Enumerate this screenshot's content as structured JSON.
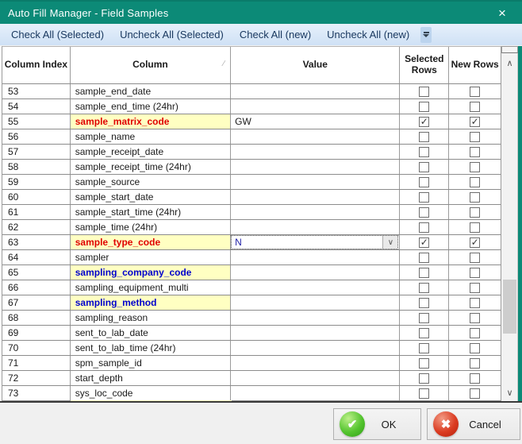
{
  "window": {
    "title": "Auto Fill Manager - Field Samples"
  },
  "icons": {
    "close": "×",
    "check": "✓",
    "chevron_down": "∨",
    "sort_ascending": "∕",
    "scroll_up": "∧",
    "scroll_down": "∨",
    "ok_check": "✔",
    "cancel_x": "✖"
  },
  "colors": {
    "titlebar_teal": "#0c8a77",
    "toolbar_blue": "#d9e8f8",
    "highlight_yellow": "#ffffc2",
    "required_red": "#e00000",
    "lookup_blue": "#0000cc",
    "ok_green": "#54c42f",
    "cancel_red": "#db3c22"
  },
  "toolbar": {
    "items": [
      "Check All (Selected)",
      "Uncheck All (Selected)",
      "Check All (new)",
      "Uncheck All (new)"
    ]
  },
  "table": {
    "headers": {
      "index": "Column Index",
      "column": "Column",
      "value": "Value",
      "selected": "Selected Rows",
      "new_rows": "New Rows"
    },
    "rows": [
      {
        "index": "53",
        "column": "sample_end_date",
        "value": "",
        "highlight": false,
        "style": null,
        "combo": false,
        "selected": false,
        "new_rows": false
      },
      {
        "index": "54",
        "column": "sample_end_time (24hr)",
        "value": "",
        "highlight": false,
        "style": null,
        "combo": false,
        "selected": false,
        "new_rows": false
      },
      {
        "index": "55",
        "column": "sample_matrix_code",
        "value": "GW",
        "highlight": true,
        "style": "red",
        "combo": false,
        "selected": true,
        "new_rows": true
      },
      {
        "index": "56",
        "column": "sample_name",
        "value": "",
        "highlight": false,
        "style": null,
        "combo": false,
        "selected": false,
        "new_rows": false
      },
      {
        "index": "57",
        "column": "sample_receipt_date",
        "value": "",
        "highlight": false,
        "style": null,
        "combo": false,
        "selected": false,
        "new_rows": false
      },
      {
        "index": "58",
        "column": "sample_receipt_time (24hr)",
        "value": "",
        "highlight": false,
        "style": null,
        "combo": false,
        "selected": false,
        "new_rows": false
      },
      {
        "index": "59",
        "column": "sample_source",
        "value": "",
        "highlight": false,
        "style": null,
        "combo": false,
        "selected": false,
        "new_rows": false
      },
      {
        "index": "60",
        "column": "sample_start_date",
        "value": "",
        "highlight": false,
        "style": null,
        "combo": false,
        "selected": false,
        "new_rows": false
      },
      {
        "index": "61",
        "column": "sample_start_time (24hr)",
        "value": "",
        "highlight": false,
        "style": null,
        "combo": false,
        "selected": false,
        "new_rows": false
      },
      {
        "index": "62",
        "column": "sample_time (24hr)",
        "value": "",
        "highlight": false,
        "style": null,
        "combo": false,
        "selected": false,
        "new_rows": false
      },
      {
        "index": "63",
        "column": "sample_type_code",
        "value": "N",
        "highlight": true,
        "style": "red",
        "combo": true,
        "selected": true,
        "new_rows": true
      },
      {
        "index": "64",
        "column": "sampler",
        "value": "",
        "highlight": false,
        "style": null,
        "combo": false,
        "selected": false,
        "new_rows": false
      },
      {
        "index": "65",
        "column": "sampling_company_code",
        "value": "",
        "highlight": true,
        "style": "blue",
        "combo": false,
        "selected": false,
        "new_rows": false
      },
      {
        "index": "66",
        "column": "sampling_equipment_multi",
        "value": "",
        "highlight": false,
        "style": null,
        "combo": false,
        "selected": false,
        "new_rows": false
      },
      {
        "index": "67",
        "column": "sampling_method",
        "value": "",
        "highlight": true,
        "style": "blue",
        "combo": false,
        "selected": false,
        "new_rows": false
      },
      {
        "index": "68",
        "column": "sampling_reason",
        "value": "",
        "highlight": false,
        "style": null,
        "combo": false,
        "selected": false,
        "new_rows": false
      },
      {
        "index": "69",
        "column": "sent_to_lab_date",
        "value": "",
        "highlight": false,
        "style": null,
        "combo": false,
        "selected": false,
        "new_rows": false
      },
      {
        "index": "70",
        "column": "sent_to_lab_time (24hr)",
        "value": "",
        "highlight": false,
        "style": null,
        "combo": false,
        "selected": false,
        "new_rows": false
      },
      {
        "index": "71",
        "column": "spm_sample_id",
        "value": "",
        "highlight": false,
        "style": null,
        "combo": false,
        "selected": false,
        "new_rows": false
      },
      {
        "index": "72",
        "column": "start_depth",
        "value": "",
        "highlight": false,
        "style": null,
        "combo": false,
        "selected": false,
        "new_rows": false
      },
      {
        "index": "73",
        "column": "sys_loc_code",
        "value": "",
        "highlight": false,
        "style": null,
        "combo": false,
        "selected": false,
        "new_rows": false
      }
    ]
  },
  "buttons": {
    "ok": "OK",
    "cancel": "Cancel"
  }
}
